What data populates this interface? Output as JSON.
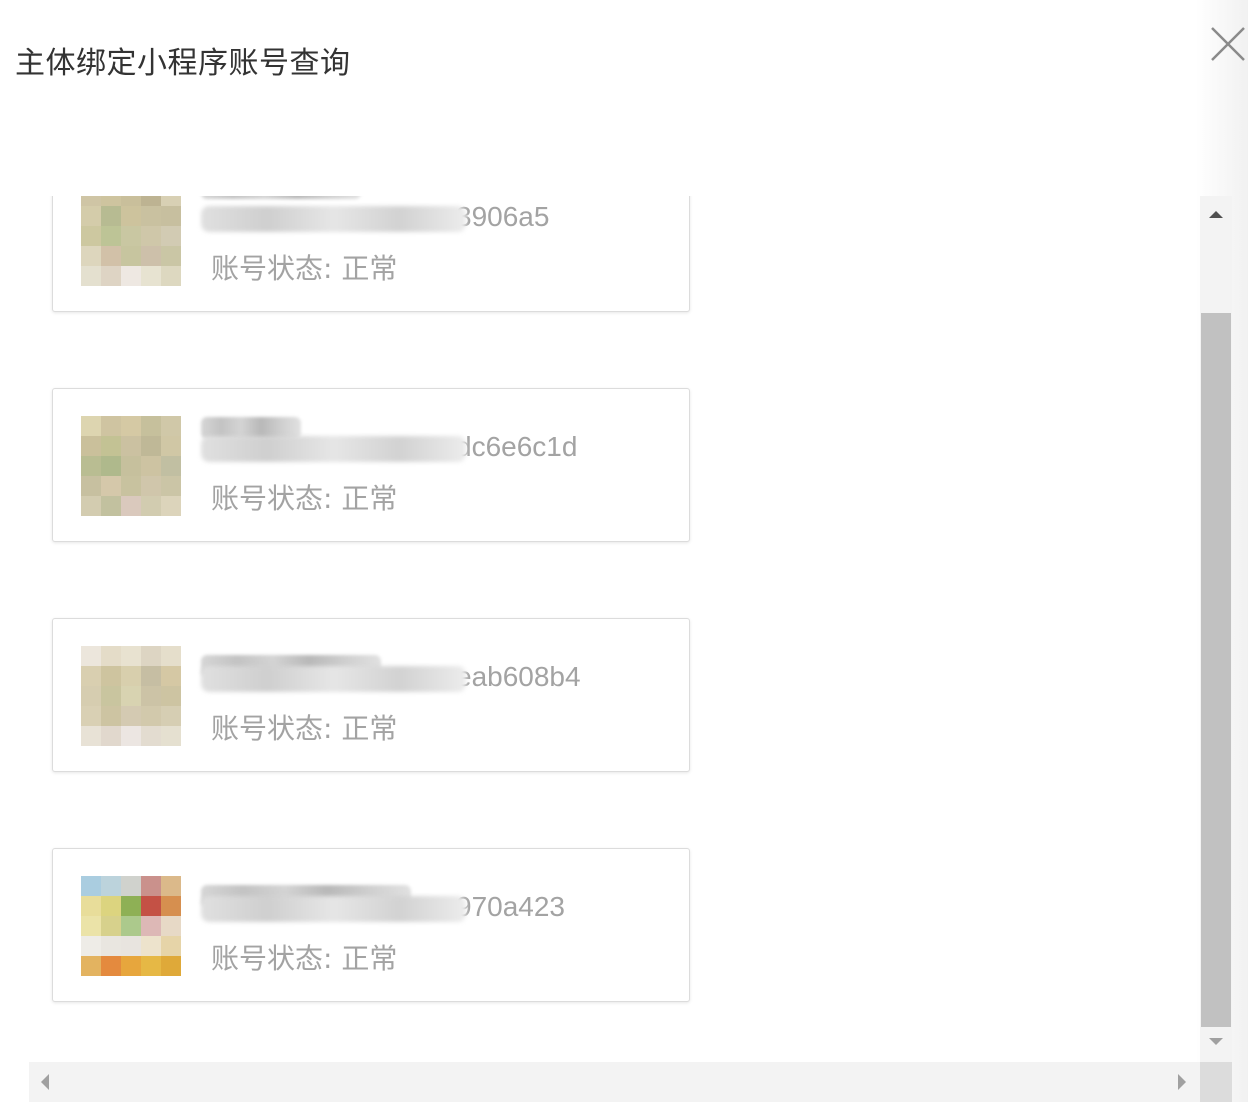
{
  "dialog": {
    "title": "主体绑定小程序账号查询"
  },
  "accounts": [
    {
      "name": "",
      "id_visible": "3906a5",
      "status": "账号状态: 正常",
      "avatar_colors": [
        "#cfc5a5",
        "#cec49f",
        "#c9bf9b",
        "#bdb392",
        "#d8d0b4",
        "#d4ccaa",
        "#b7bb92",
        "#cdc39d",
        "#c9c1a0",
        "#c7bf9f",
        "#cdc8a0",
        "#bdc496",
        "#c9c7a2",
        "#cfc7a9",
        "#d2cbb3",
        "#ddd6bd",
        "#d2c1a8",
        "#c7c59f",
        "#cdc0aa",
        "#cac6a5",
        "#e4e0cf",
        "#ded4c4",
        "#eee8e2",
        "#e7e3d1",
        "#ddd8c0"
      ]
    },
    {
      "name": "",
      "id_visible": "dc6e6c1d",
      "status": "账号状态: 正常",
      "avatar_colors": [
        "#ddd5b0",
        "#cfc4a1",
        "#d5c9a4",
        "#c6c09c",
        "#d0c8a8",
        "#cac09b",
        "#c3c294",
        "#cbc1a1",
        "#bfb897",
        "#d0c7a5",
        "#b9bd92",
        "#afb98c",
        "#c6c09d",
        "#cdc3a2",
        "#c1bfa2",
        "#c7c0a0",
        "#d5c8aa",
        "#c8c29f",
        "#d0c6ab",
        "#cbc5a6",
        "#d3ccb0",
        "#c2c19f",
        "#dac9bd",
        "#d2ccb0",
        "#dcd4bb"
      ]
    },
    {
      "name": "",
      "id_visible": "eab608b4",
      "status": "账号状态: 正常",
      "avatar_colors": [
        "#ece6dc",
        "#e4dcc8",
        "#e8e2d0",
        "#ddd5c3",
        "#e5decb",
        "#d9cfb0",
        "#cec49f",
        "#d8cfad",
        "#c6bea3",
        "#d5c8a4",
        "#d6cdb0",
        "#c9c59f",
        "#d8d3b1",
        "#ccc3a6",
        "#cdc4a2",
        "#d9d0b4",
        "#cdc4a2",
        "#d4cab2",
        "#d2c9ac",
        "#d6ceb3",
        "#e8e2d6",
        "#e1d8cd",
        "#ece6e2",
        "#e3dcd0",
        "#e5e0d0"
      ]
    },
    {
      "name": "",
      "id_visible": "970a423",
      "status": "账号状态: 正常",
      "avatar_colors": [
        "#aacde0",
        "#bcd3dc",
        "#d0d2cd",
        "#ca918c",
        "#dbb98a",
        "#e8dd9a",
        "#dcd47f",
        "#8eb055",
        "#c45145",
        "#d68f4f",
        "#ebe3a8",
        "#d7d18c",
        "#acc98c",
        "#ddb8b6",
        "#e7d9c6",
        "#eeece7",
        "#e9e6e0",
        "#e8e4df",
        "#ede3cc",
        "#e6d4a8",
        "#e3b360",
        "#e48a3e",
        "#e7a63d",
        "#e6b845",
        "#dfa939"
      ]
    }
  ]
}
